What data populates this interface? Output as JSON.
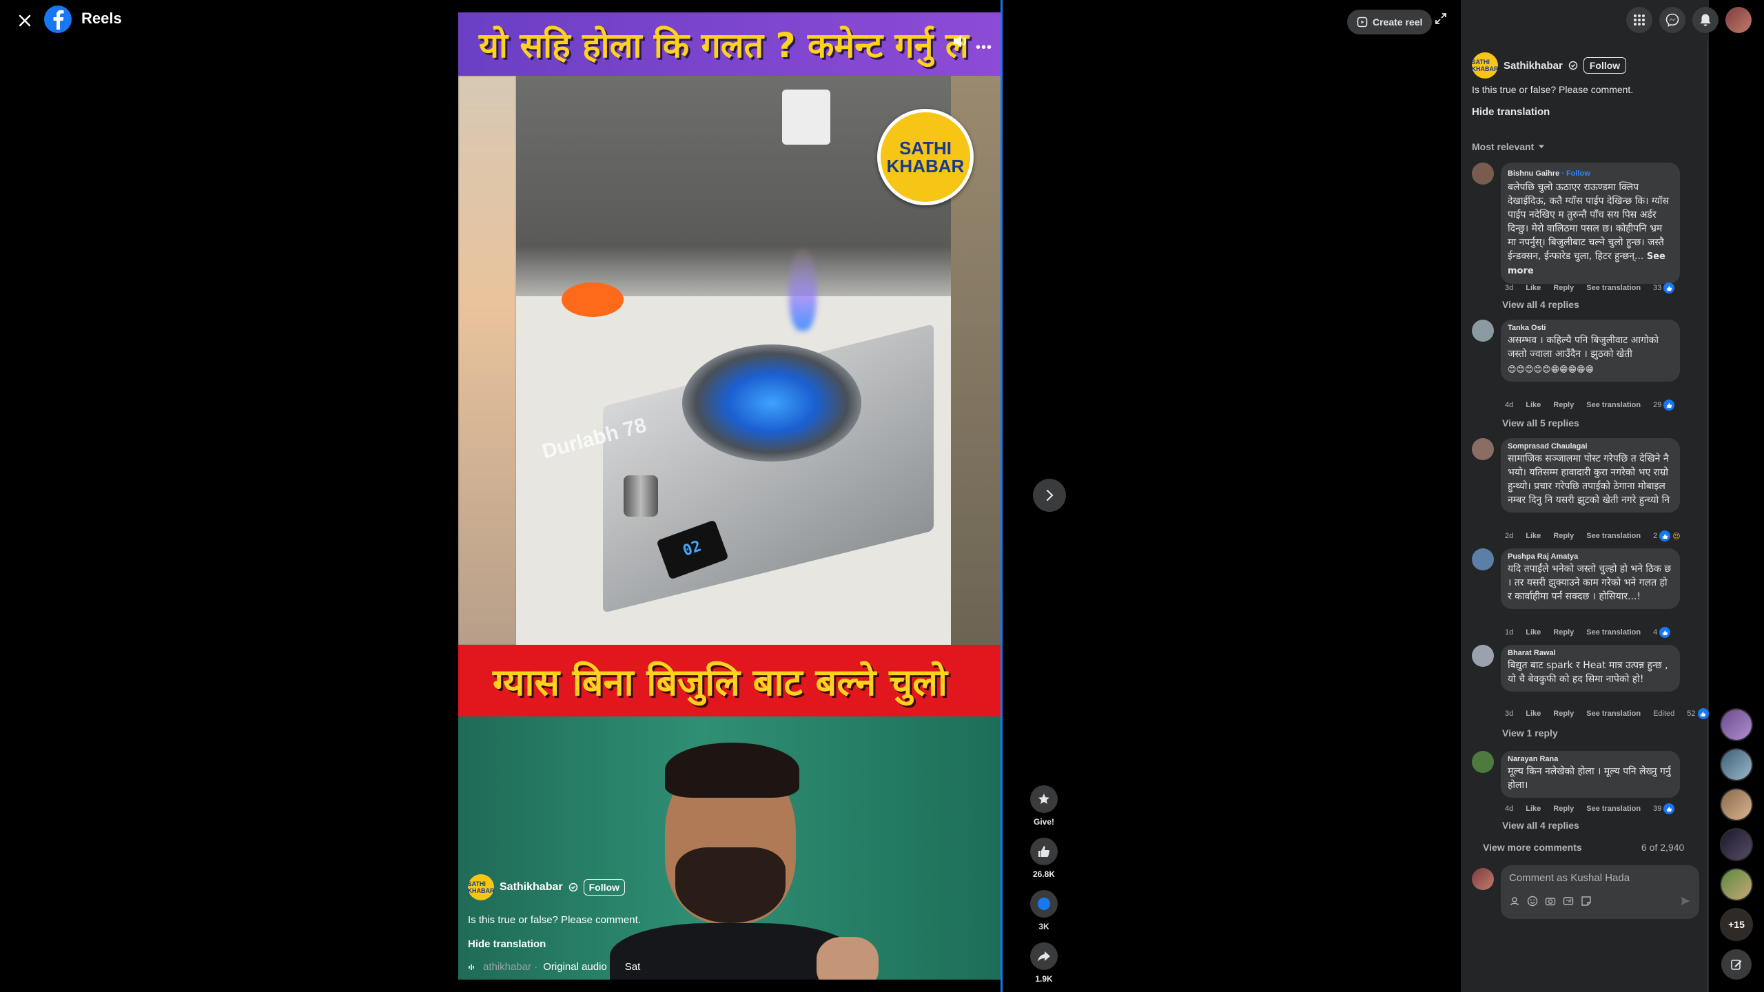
{
  "header": {
    "title": "Reels"
  },
  "video": {
    "top_banner": "यो सहि होला कि गलत ? कमेन्ट गर्नु ल",
    "bottom_banner": "ग्यास बिना बिजुलि बाट बल्ने चुलो",
    "logo_line1": "SATHI",
    "logo_line2": "KHABAR",
    "watermark": "Durlabh 78",
    "stove_display": "02",
    "overlay": {
      "avatar_text": "SATHI KHABAR",
      "author": "Sathikhabar",
      "follow": "Follow",
      "caption": "Is this true or false? Please comment.",
      "hide_translation": "Hide translation",
      "audio_faded": "athikhabar ·",
      "audio": "Original audio",
      "audio_next": "Sat"
    }
  },
  "actions": {
    "give": "Give!",
    "likes": "26.8K",
    "comments": "3K",
    "shares": "1.9K"
  },
  "toolbar": {
    "create_reel": "Create reel"
  },
  "panel": {
    "author": "Sathikhabar",
    "avatar_text": "SATHI KHABAR",
    "follow": "Follow",
    "caption": "Is this true or false? Please comment.",
    "hide_translation": "Hide translation",
    "sort": "Most relevant",
    "comments": [
      {
        "name": "Bishnu Gaihre",
        "follow": " · Follow",
        "text": "बलेपछि चुलो ऊठाएर राऊण्डमा क्लिप देखाईदिऊ, कतै ग्यॉस पाईप देखिन्छ कि। ग्यॉस पाईप नदेखिए म तुरुन्तै पाँच सय पिस अर्डर दिन्छु। मेरो वालिठमा पसल छ। कोहीपनि भ्रम मा नपर्नुस्। बिजुलीबाट चल्ने चुलो हुन्छ। जस्तै ईन्डक्सन, ईन्फारेड चुला, हिटर हुन्छन्...",
        "see_more": "See more",
        "time": "3d",
        "like": "Like",
        "reply": "Reply",
        "translation": "See translation",
        "count": "33",
        "replies": "View all 4 replies",
        "avatar_color": "#7a5c4f"
      },
      {
        "name": "Tanka Osti",
        "text": "असम्भव । कहिल्यै पनि बिजुलीवाट आगोको जस्तो ज्वाला आउँदैन । झुठको खेती",
        "emojis": "😊😊😊😊😊😁😁😁😁😁",
        "time": "4d",
        "like": "Like",
        "reply": "Reply",
        "translation": "See translation",
        "count": "29",
        "replies": "View all 5 replies",
        "avatar_color": "#8a9aa0"
      },
      {
        "name": "Somprasad Chaulagai",
        "text": "सामाजिक सञ्जालमा पोस्ट गरेपछि त देखिने नै भयो। यतिसम्म हावादारी कुरा नगरेको भए राम्रो हुन्थ्यो। प्रचार गरेपछि तपाईको ठेगाना मोबाइल नम्बर दिनु नि यसरी झुटको खेती नगरे हुन्थ्यो नि",
        "time": "2d",
        "like": "Like",
        "reply": "Reply",
        "translation": "See translation",
        "count": "2",
        "avatar_color": "#8b6e63"
      },
      {
        "name": "Pushpa Raj Amatya",
        "text": "यदि तपाईंले भनेको जस्तो चुल्हो हो भने ठिक छ । तर यसरी झुक्याउने काम गरेको भने गलत हो र कार्वाहीमा पर्न सक्दछ । होसियार...!",
        "time": "1d",
        "like": "Like",
        "reply": "Reply",
        "translation": "See translation",
        "count": "4",
        "avatar_color": "#5b7fa6"
      },
      {
        "name": "Bharat Rawal",
        "text": "बिद्युत बाट spark र Heat मात्र उत्पन्न हुन्छ , यो चै बेवकुफी को हद सिमा नापेको हो!",
        "time": "3d",
        "like": "Like",
        "reply": "Reply",
        "translation": "See translation",
        "edited": "Edited",
        "count": "52",
        "replies": "View 1 reply",
        "avatar_color": "#9aa3ad"
      },
      {
        "name": "Narayan Rana",
        "text": "मूल्य किन नलेखेको होला । मूल्य पनि लेख्नु गर्नु होला।",
        "time": "4d",
        "like": "Like",
        "reply": "Reply",
        "translation": "See translation",
        "count": "39",
        "replies": "View all 4 replies",
        "avatar_color": "#4f7a3f"
      }
    ],
    "view_more": "View more comments",
    "count_of": "6 of 2,940",
    "composer_placeholder": "Comment as Kushal Hada"
  },
  "contacts": {
    "more": "+15"
  },
  "colors": {
    "brand": "#1877f2",
    "panel": "#242526",
    "bubble": "#3a3b3c"
  }
}
